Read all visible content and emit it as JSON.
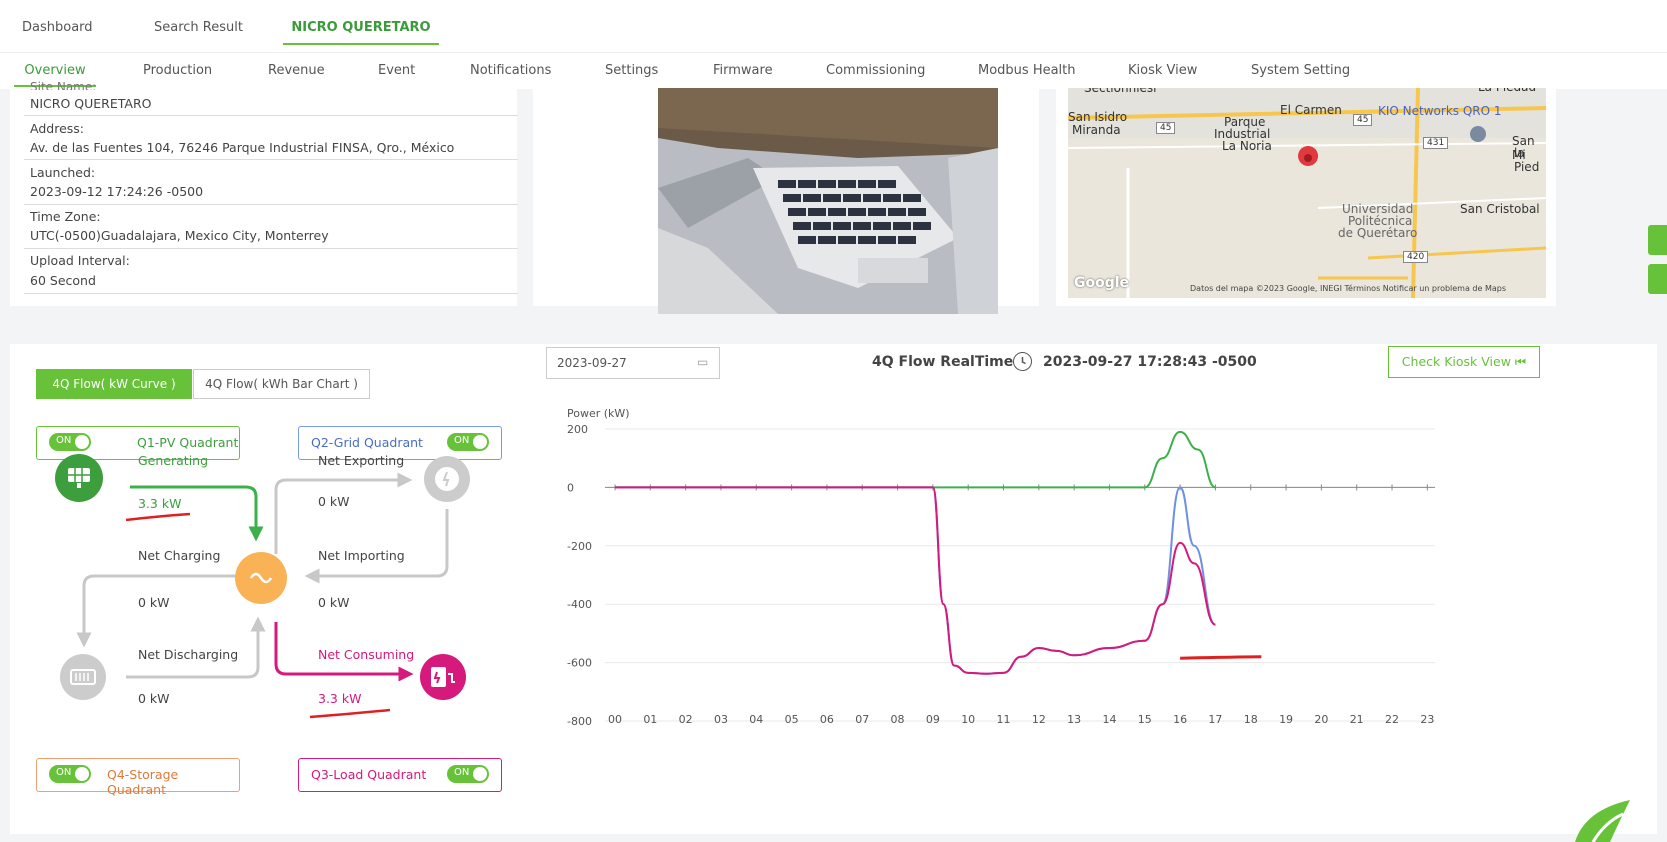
{
  "breadcrumbs": [
    "Dashboard",
    "Search Result",
    "NICRO QUERETARO"
  ],
  "subnav": [
    "Overview",
    "Production",
    "Revenue",
    "Event",
    "Notifications",
    "Settings",
    "Firmware",
    "Commissioning",
    "Modbus Health",
    "Kiosk View",
    "System Setting"
  ],
  "site_info": {
    "name_label": "Site Name:",
    "name": "NICRO QUERETARO",
    "address_label": "Address:",
    "address": "Av. de las Fuentes 104, 76246 Parque Industrial FINSA, Qro., México",
    "launched_label": "Launched:",
    "launched": "2023-09-12 17:24:26 -0500",
    "timezone_label": "Time Zone:",
    "timezone": "UTC(-0500)Guadalajara, Mexico City, Monterrey",
    "upload_label": "Upload Interval:",
    "upload": "60 Second"
  },
  "map": {
    "labels": [
      "Sectionniesi",
      "San Isidro",
      "Miranda",
      "Parque",
      "Industrial",
      "La Noria",
      "El Carmen",
      "KIO Networks QRO 1",
      "San Mi",
      "la Pied",
      "Universidad",
      "Politécnica",
      "de Querétaro",
      "San Cristobal",
      "La Piedad"
    ],
    "road_badges": [
      "45",
      "45",
      "431",
      "420"
    ],
    "google": "Google",
    "footer": "Datos del mapa ©2023 Google, INEGI   Términos   Notificar un problema de Maps"
  },
  "flow_panel": {
    "tab_active": "4Q Flow( kW Curve )",
    "tab_inactive": "4Q Flow( kWh Bar Chart )",
    "toggle_text": "ON",
    "q1": "Q1-PV Quadrant",
    "q2": "Q2-Grid Quadrant",
    "q3": "Q3-Load Quadrant",
    "q4": "Q4-Storage Quadrant",
    "generating": "Generating",
    "generating_val": "3.3 kW",
    "net_exporting": "Net Exporting",
    "net_exporting_val": "0 kW",
    "net_charging": "Net Charging",
    "net_charging_val": "0 kW",
    "net_importing": "Net Importing",
    "net_importing_val": "0 kW",
    "net_discharging": "Net Discharging",
    "net_discharging_val": "0 kW",
    "net_consuming": "Net Consuming",
    "net_consuming_val": "3.3 kW"
  },
  "realtime": {
    "date_input": "2023-09-27",
    "title": "4Q Flow RealTime",
    "timestamp": "2023-09-27 17:28:43 -0500",
    "kiosk_button": "Check Kiosk View"
  },
  "colors": {
    "green": "#67c23a",
    "pv_green": "#3c9e3c",
    "blue": "#6f8fe0",
    "pink": "#d6197c",
    "orange": "#f0a050",
    "gray": "#c8c8c8"
  },
  "chart_data": {
    "type": "line",
    "ylabel": "Power (kW)",
    "ylim": [
      -800,
      200
    ],
    "yticks": [
      200,
      0,
      -200,
      -400,
      -600,
      -800
    ],
    "x": [
      "00",
      "01",
      "02",
      "03",
      "04",
      "05",
      "06",
      "07",
      "08",
      "09",
      "10",
      "11",
      "12",
      "13",
      "14",
      "15",
      "16",
      "17",
      "18",
      "19",
      "20",
      "21",
      "22",
      "23"
    ],
    "series": [
      {
        "color": "#3cb04a",
        "points": [
          [
            0,
            0
          ],
          [
            9,
            0
          ],
          [
            10,
            0
          ],
          [
            11,
            0
          ],
          [
            12,
            0
          ],
          [
            13,
            0
          ],
          [
            14,
            0
          ],
          [
            15,
            0
          ],
          [
            15.5,
            100
          ],
          [
            16,
            190
          ],
          [
            16.5,
            130
          ],
          [
            17,
            0
          ]
        ]
      },
      {
        "color": "#6f8fe0",
        "points": [
          [
            0,
            0
          ],
          [
            9,
            0
          ],
          [
            9.3,
            -400
          ],
          [
            9.6,
            -610
          ],
          [
            10,
            -635
          ],
          [
            10.5,
            -638
          ],
          [
            11,
            -635
          ],
          [
            11.5,
            -580
          ],
          [
            12,
            -550
          ],
          [
            12.5,
            -560
          ],
          [
            13,
            -575
          ],
          [
            14,
            -550
          ],
          [
            15,
            -525
          ],
          [
            15.5,
            -400
          ],
          [
            16,
            0
          ],
          [
            16.4,
            -200
          ],
          [
            17,
            -470
          ]
        ]
      },
      {
        "color": "#d6197c",
        "points": [
          [
            0,
            0
          ],
          [
            9,
            0
          ],
          [
            9.3,
            -400
          ],
          [
            9.6,
            -610
          ],
          [
            10,
            -635
          ],
          [
            10.5,
            -638
          ],
          [
            11,
            -635
          ],
          [
            11.5,
            -580
          ],
          [
            12,
            -550
          ],
          [
            12.5,
            -560
          ],
          [
            13,
            -575
          ],
          [
            14,
            -550
          ],
          [
            15,
            -525
          ],
          [
            15.5,
            -400
          ],
          [
            16,
            -190
          ],
          [
            16.4,
            -260
          ],
          [
            17,
            -470
          ]
        ]
      }
    ]
  }
}
